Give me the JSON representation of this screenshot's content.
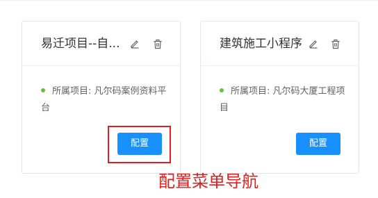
{
  "cards": [
    {
      "title": "易迁项目--自...",
      "project_text": "所属项目: 凡尔码案例资料平台",
      "config_label": "配置",
      "edit_icon": "pencil-icon",
      "delete_icon": "trash-icon"
    },
    {
      "title": "建筑施工小程序",
      "project_text": "所属项目: 凡尔码大厦工程项目",
      "config_label": "配置",
      "edit_icon": "pencil-icon",
      "delete_icon": "trash-icon"
    }
  ],
  "annotation": {
    "text": "配置菜单导航",
    "color": "#e02020"
  },
  "colors": {
    "primary_button": "#1890ff",
    "status_dot": "#67c23a",
    "annotation": "#e02020"
  }
}
